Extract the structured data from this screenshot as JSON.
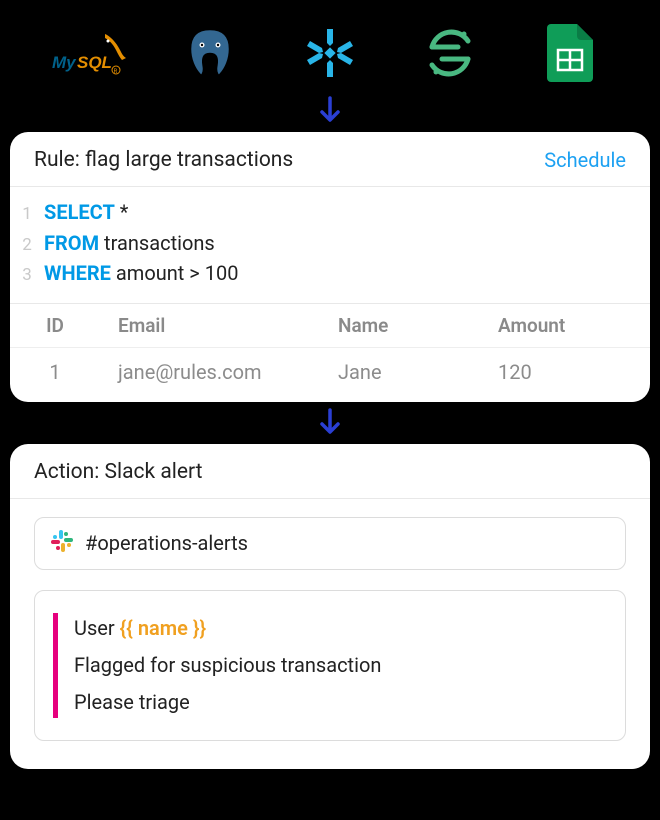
{
  "logos": [
    "mysql",
    "postgres",
    "snowflake",
    "segment",
    "sheets"
  ],
  "rule": {
    "title": "Rule: flag large transactions",
    "schedule_label": "Schedule",
    "sql": {
      "line1_kw": "SELECT",
      "line1_rest": " *",
      "line2_kw": "FROM",
      "line2_rest": " transactions",
      "line3_kw": "WHERE",
      "line3_rest": " amount > 100",
      "n1": "1",
      "n2": "2",
      "n3": "3"
    },
    "columns": {
      "id": "ID",
      "email": "Email",
      "name": "Name",
      "amount": "Amount"
    },
    "row": {
      "id": "1",
      "email": "jane@rules.com",
      "name": "Jane",
      "amount": "120"
    }
  },
  "action": {
    "title": "Action: Slack alert",
    "channel": "#operations-alerts",
    "msg_line1_prefix": "User ",
    "msg_line1_var": "{{ name }}",
    "msg_line2": "Flagged for suspicious transaction",
    "msg_line3": "Please triage"
  }
}
